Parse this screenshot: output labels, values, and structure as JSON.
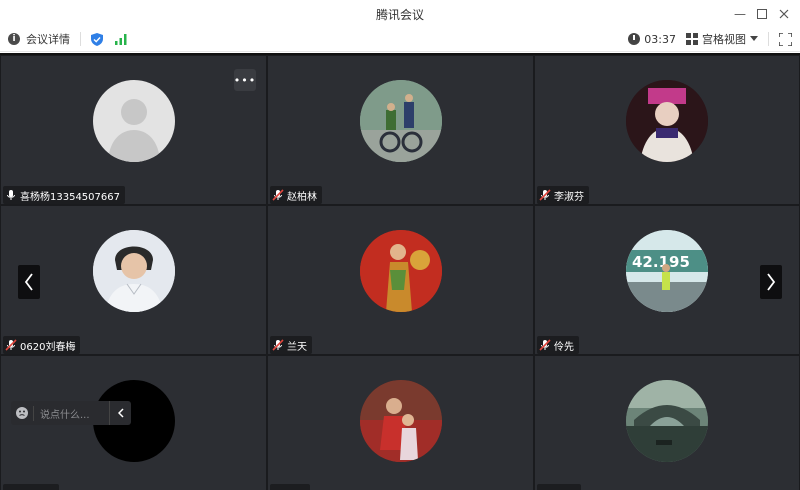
{
  "window": {
    "title": "腾讯会议"
  },
  "toolbar": {
    "meeting_details": "会议详情",
    "timer": "03:37",
    "view_mode": "宫格视图"
  },
  "participants": [
    {
      "name": "喜杨杨13354507667",
      "avatar": "default-avatar",
      "mic": "on"
    },
    {
      "name": "赵柏林",
      "avatar": "photo-bicycle",
      "mic": "muted"
    },
    {
      "name": "李淑芬",
      "avatar": "photo-costume",
      "mic": "muted"
    },
    {
      "name": "0620刘春梅",
      "avatar": "photo-portrait",
      "mic": "muted"
    },
    {
      "name": "兰天",
      "avatar": "photo-red-backdrop",
      "mic": "muted"
    },
    {
      "name": "伶先",
      "avatar": "photo-marathon",
      "mic": "muted"
    },
    {
      "name": "",
      "avatar": "photo-black",
      "mic": ""
    },
    {
      "name": "",
      "avatar": "photo-grandparent-child",
      "mic": ""
    },
    {
      "name": "",
      "avatar": "photo-bridge",
      "mic": ""
    }
  ],
  "chat": {
    "placeholder": "说点什么..."
  },
  "colors": {
    "stage_bg": "#1f2024",
    "tile_bg": "#2c2e33",
    "muted_red": "#e0463d",
    "signal_green": "#27b34b",
    "shield_blue": "#2f7fe6"
  }
}
